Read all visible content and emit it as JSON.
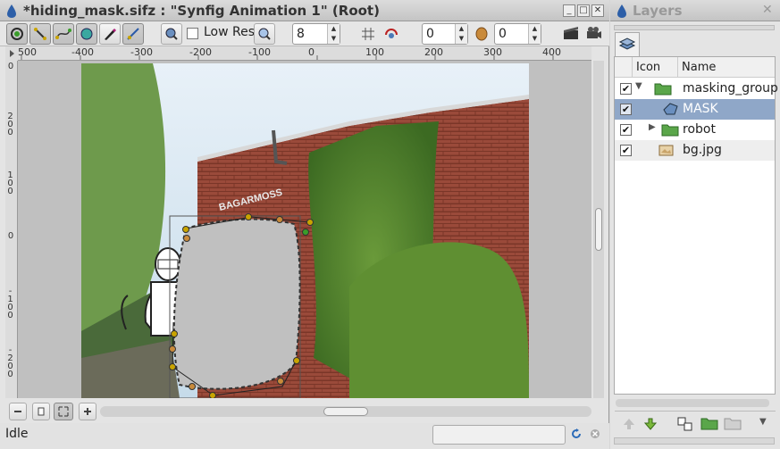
{
  "window": {
    "title": "*hiding_mask.sifz : \"Synfig Animation 1\" (Root)"
  },
  "toolbar": {
    "low_res_label": "Low Res",
    "zoom_value": "8",
    "time_value": "0",
    "frame_value": "0",
    "tools": [
      "transform-tool",
      "smooth-move-tool",
      "spline-tool",
      "circle-tool",
      "draw-tool",
      "bline-tool"
    ]
  },
  "ruler": {
    "h_labels": [
      "500",
      "-400",
      "-300",
      "-200",
      "-100",
      "0",
      "100",
      "200",
      "300",
      "400"
    ],
    "v_labels": [
      "0",
      "200",
      "100",
      "0",
      "-100",
      "-200"
    ]
  },
  "status": {
    "text": "Idle"
  },
  "layers": {
    "title": "Layers",
    "col_icon": "Icon",
    "col_name": "Name",
    "rows": [
      {
        "name": "masking_group",
        "checked": true,
        "icon": "folder-icon",
        "expander": "expanded"
      },
      {
        "name": "MASK",
        "checked": true,
        "icon": "region-icon",
        "selected": true
      },
      {
        "name": "robot",
        "checked": true,
        "icon": "folder-icon",
        "expander": "collapsed"
      },
      {
        "name": "bg.jpg",
        "checked": true,
        "icon": "image-icon"
      }
    ]
  },
  "colors": {
    "selection": "#8fa7c8",
    "sky": "#c9e0f0",
    "brick": "#9a4a3a",
    "ivy": "#4f7e2c",
    "mask_fill": "#c0c0c0",
    "handle": "#c9a400"
  }
}
